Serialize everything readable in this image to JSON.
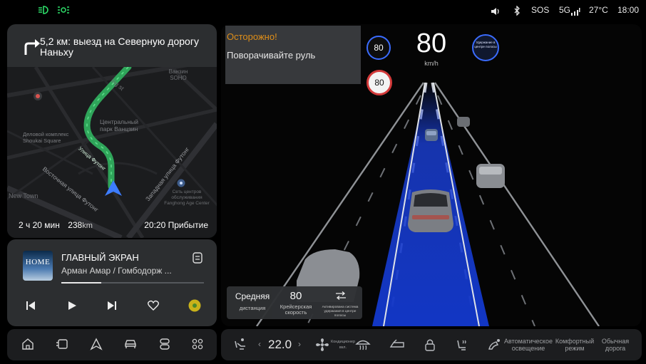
{
  "status_bar": {
    "left_icons": [
      "low-beam-icon",
      "parking-lights-icon"
    ],
    "sos": "SOS",
    "network": "5G",
    "temperature": "27°C",
    "time": "18:00",
    "right_icons": [
      "volume-icon",
      "bluetooth-icon",
      "signal-icon"
    ]
  },
  "navigation": {
    "instruction": "5,2 км: выезд на Северную дорогу Наньху",
    "eta_duration_value": "2 ч 20 мин",
    "distance_value": "238",
    "distance_unit": "km",
    "arrival": "20:20 Прибытие",
    "map_labels": {
      "poi_1": "Ванзин SOHO",
      "park": "Центральный парк Ванцзин",
      "complex": "Деловой комплекс Shoukai Square",
      "street_futong_1": "Улица Футонг",
      "street_east": "Восточная улица Футонг",
      "street_west": "Западная улица Футонг",
      "service_center": "Сеть центров обслуживания Fanghong Age Center",
      "new_town": "New Town",
      "street_top": "Ing st"
    }
  },
  "media": {
    "title": "ГЛАВНЫЙ ЭКРАН",
    "artist": "Арман Амар / Гомбодорж ...",
    "album_art_text": "HOME",
    "progress": 0.28
  },
  "driving": {
    "warning_title": "Осторожно!",
    "warning_message": "Поворачивайте руль",
    "speed": "80",
    "speed_unit": "km/h",
    "set_speed_badge": "80",
    "speed_limit_sign": "80",
    "lane_keep_badge": "Удержание в центре полосы",
    "cruise": {
      "distance_label": "Средняя",
      "distance_sub": "дистанция",
      "speed_value": "80",
      "speed_label": "Крейсерская скорость",
      "lane_label": "Активирована система удержания в центре полосы"
    },
    "colors": {
      "lane_highlight": "#1a3fd6",
      "warning": "#e8941a"
    }
  },
  "dock": {
    "temperature": "22.0",
    "fan_label": "Кондиционер вкл.",
    "auto_light": "Автоматическое освещение",
    "comfort_mode": "Комфортный режим",
    "normal_road": "Обычная дорога"
  }
}
